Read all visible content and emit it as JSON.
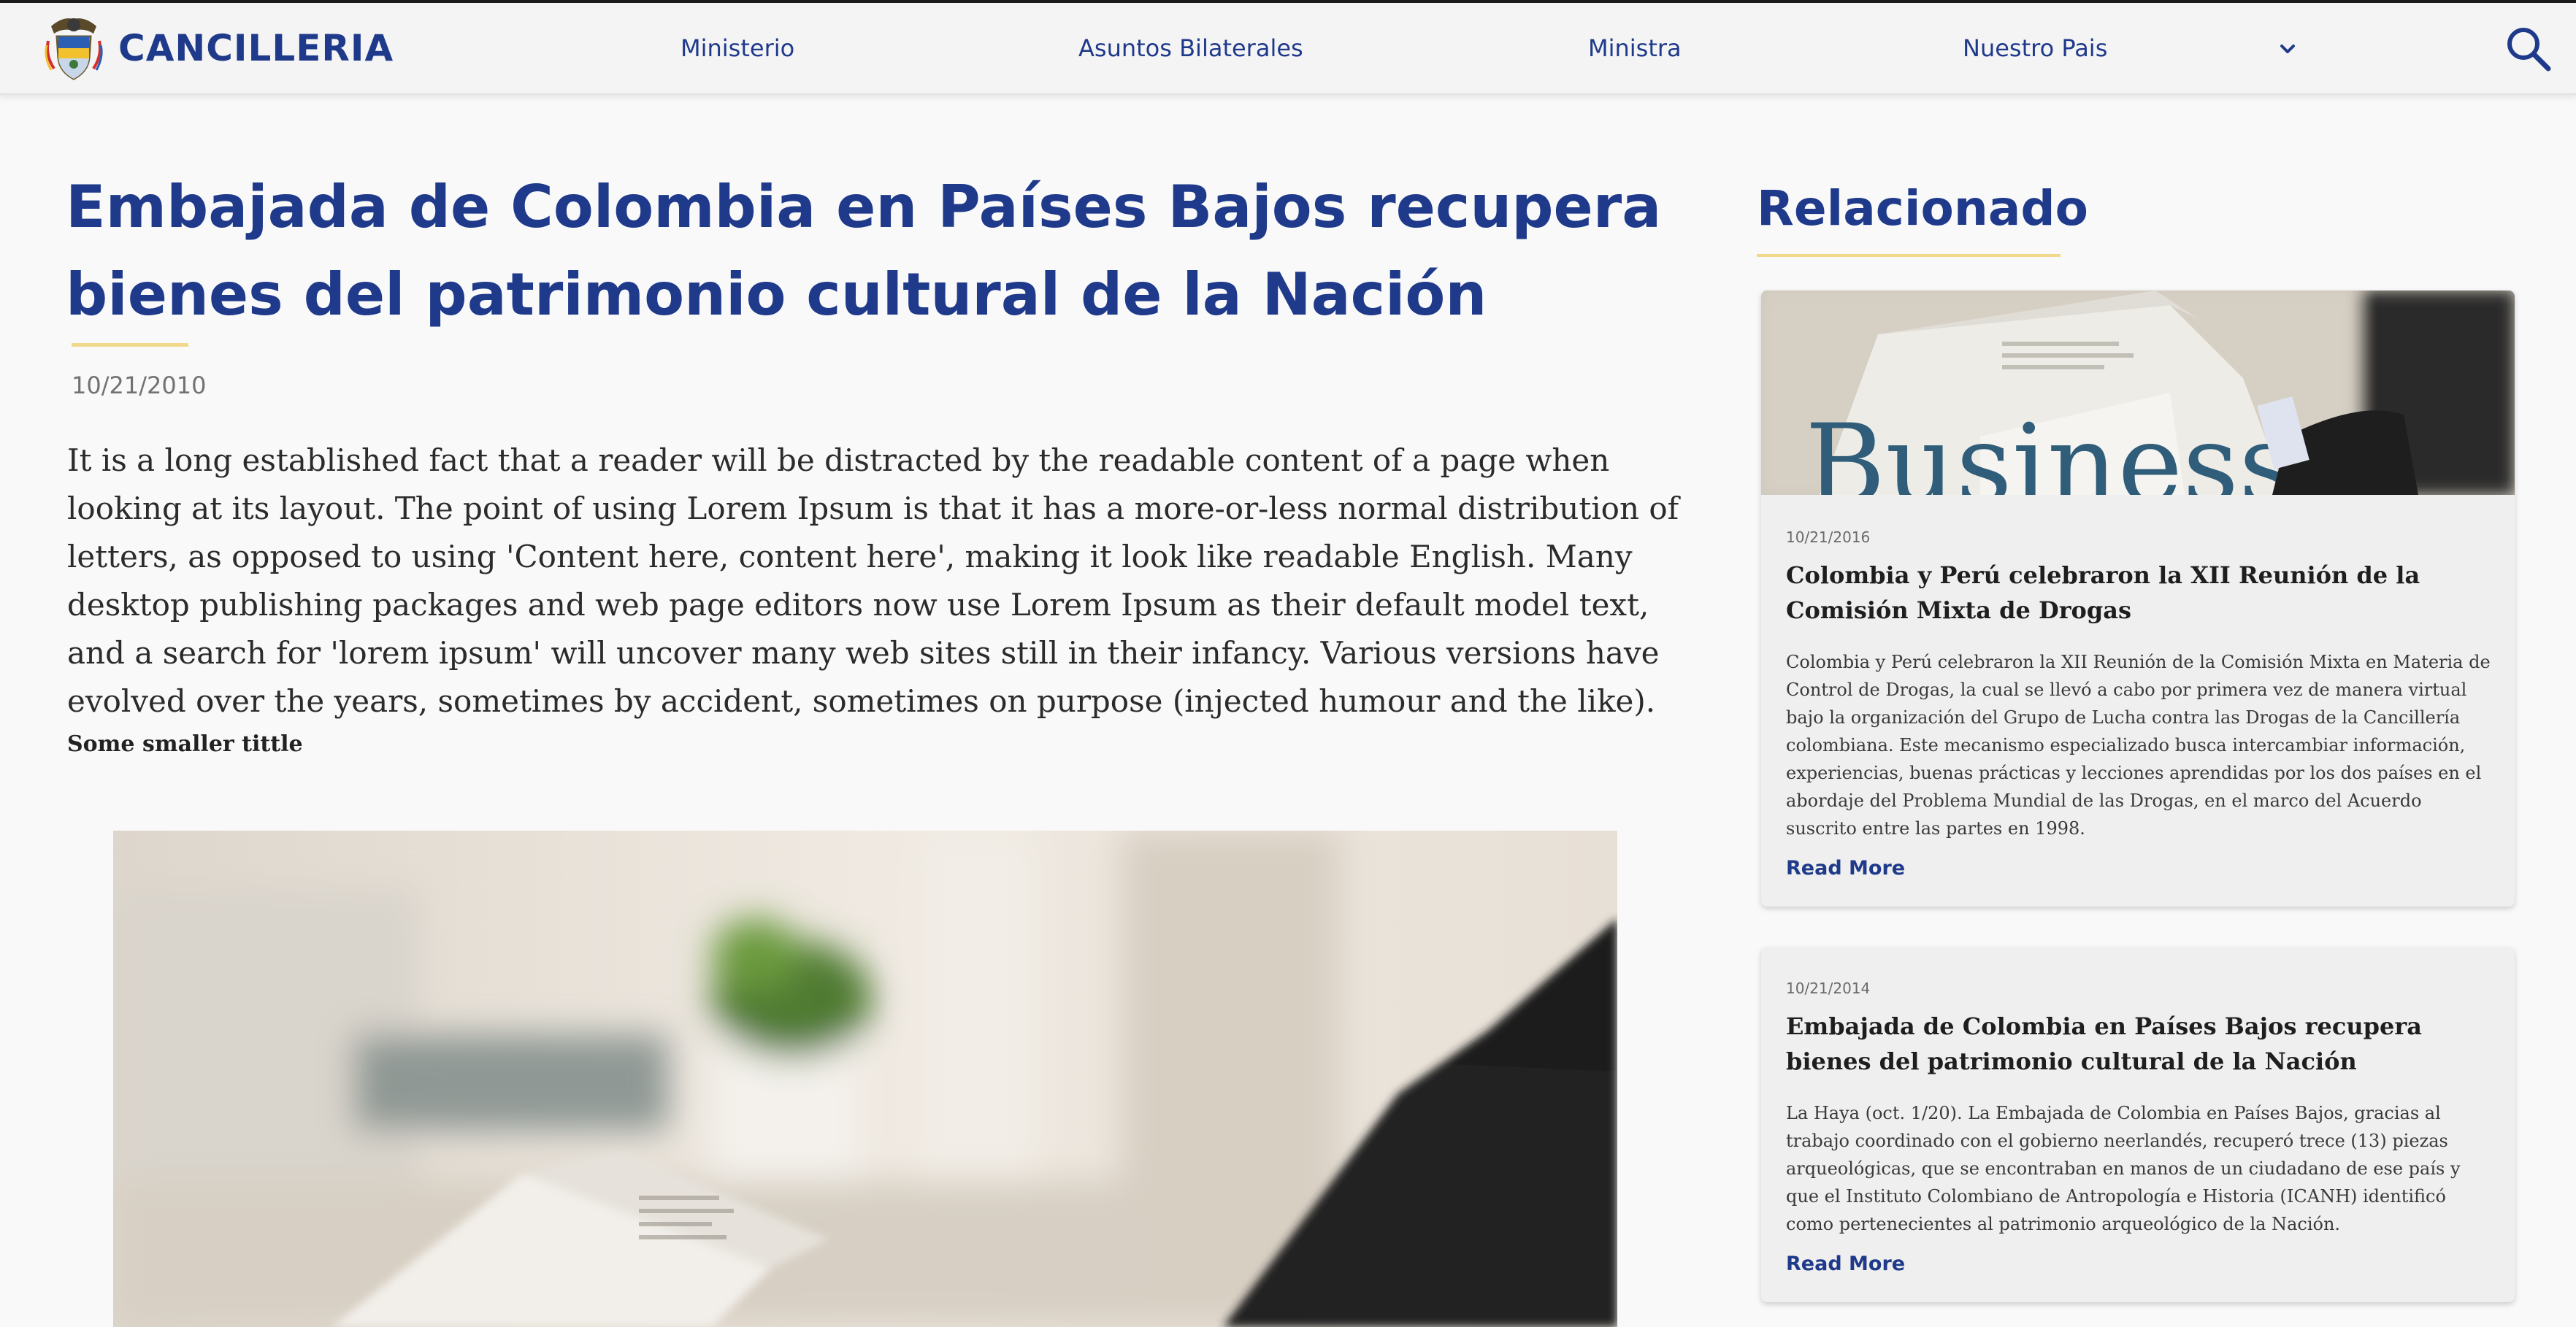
{
  "header": {
    "brand": "CANCILLERIA",
    "nav": [
      {
        "label": "Ministerio"
      },
      {
        "label": "Asuntos Bilaterales"
      },
      {
        "label": "Ministra"
      },
      {
        "label": "Nuestro Pais"
      }
    ],
    "icons": {
      "logo": "colombia-coat-of-arms-icon",
      "more": "chevron-down-icon",
      "search": "search-icon"
    }
  },
  "article": {
    "title": "Embajada de Colombia en Países Bajos recupera bienes del patrimonio cultural de la Nación",
    "date": "10/21/2010",
    "body": "It is a long established fact that a reader will be distracted by the readable content of a page when looking at its layout. The point of using Lorem Ipsum is that it has a more-or-less normal distribution of letters, as opposed to using 'Content here, content here', making it look like readable English. Many desktop publishing packages and web page editors now use Lorem Ipsum as their default model text, and a search for 'lorem ipsum' will uncover many web sites still in their infancy. Various versions have evolved over the years, sometimes by accident, sometimes on purpose (injected humour and the like).",
    "subtitle": "Some smaller tittle",
    "hero_image_text": ""
  },
  "sidebar": {
    "title": "Relacionado",
    "cards": [
      {
        "image_text": "Business",
        "date": "10/21/2016",
        "title": "Colombia y Perú celebraron la XII Reunión de la Comisión Mixta de Drogas",
        "text": "Colombia y Perú celebraron la XII Reunión de la Comisión Mixta en Materia de Control de Drogas, la cual se llevó a cabo por primera vez de manera virtual bajo la organización del Grupo de Lucha contra las Drogas de la Cancillería colombiana. Este mecanismo especializado busca intercambiar información, experiencias, buenas prácticas y lecciones aprendidas por los dos países en el abordaje del Problema Mundial de las Drogas, en el marco del Acuerdo suscrito entre las partes en 1998.",
        "link": "Read More"
      },
      {
        "date": "10/21/2014",
        "title": "Embajada de Colombia en Países Bajos recupera bienes del patrimonio cultural de la Nación",
        "text": "La Haya (oct. 1/20). La Embajada de Colombia en Países Bajos, gracias al trabajo coordinado con el gobierno neerlandés, recuperó trece (13) piezas arqueológicas, que se encontraban en manos de un ciudadano de ese país y que el Instituto Colombiano de Antropología e Historia (ICANH) identificó como pertenecientes al patrimonio arqueológico de la Nación.",
        "link": "Read More"
      }
    ]
  },
  "colors": {
    "brand_blue": "#1f3a8a",
    "accent_gold": "#f0d98a",
    "page_bg": "#f9f9fa"
  }
}
